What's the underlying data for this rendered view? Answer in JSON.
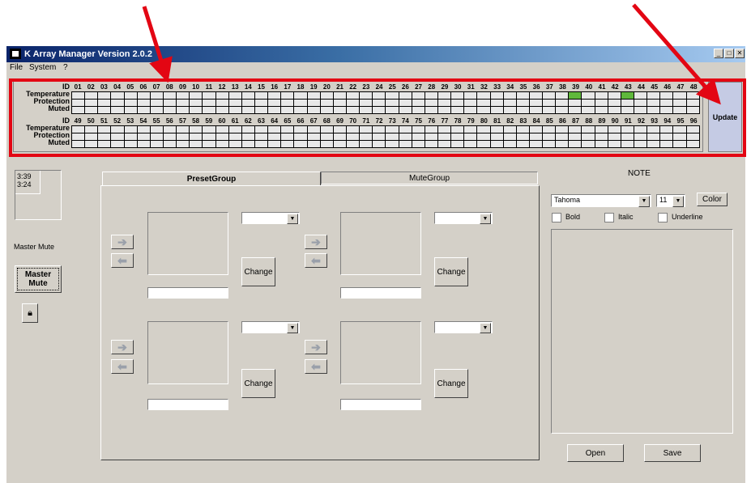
{
  "window": {
    "title": "K Array Manager Version 2.0.2",
    "caption_buttons": [
      "_",
      "□",
      "✕"
    ]
  },
  "menu": [
    "File",
    "System",
    "?"
  ],
  "status": {
    "id_label": "ID",
    "rows": [
      "Temperature",
      "Protection",
      "Muted"
    ],
    "top_ids": [
      "01",
      "02",
      "03",
      "04",
      "05",
      "06",
      "07",
      "08",
      "09",
      "10",
      "11",
      "12",
      "13",
      "14",
      "15",
      "16",
      "17",
      "18",
      "19",
      "20",
      "21",
      "22",
      "23",
      "24",
      "25",
      "26",
      "27",
      "28",
      "29",
      "30",
      "31",
      "32",
      "33",
      "34",
      "35",
      "36",
      "37",
      "38",
      "39",
      "40",
      "41",
      "42",
      "43",
      "44",
      "45",
      "46",
      "47",
      "48"
    ],
    "bottom_ids": [
      "49",
      "50",
      "51",
      "52",
      "53",
      "54",
      "55",
      "56",
      "57",
      "58",
      "59",
      "60",
      "61",
      "62",
      "63",
      "64",
      "65",
      "66",
      "67",
      "68",
      "69",
      "70",
      "71",
      "72",
      "73",
      "74",
      "75",
      "76",
      "77",
      "78",
      "79",
      "80",
      "81",
      "82",
      "83",
      "84",
      "85",
      "86",
      "87",
      "88",
      "89",
      "90",
      "91",
      "92",
      "93",
      "94",
      "95",
      "96"
    ],
    "active_top": [
      38,
      42
    ],
    "active_color": "#5fb83b",
    "update_label": "Update"
  },
  "left": {
    "time": "3:39\n3:24",
    "master_mute_caption": "Master Mute",
    "master_mute_button": "Master\nMute"
  },
  "tabs": [
    "PresetGroup",
    "MuteGroup"
  ],
  "groups": [
    {
      "change_label": "Change"
    },
    {
      "change_label": "Change"
    },
    {
      "change_label": "Change"
    },
    {
      "change_label": "Change"
    }
  ],
  "note": {
    "title": "NOTE",
    "font_family": "Tahoma",
    "font_size": "11",
    "color_button": "Color",
    "bold": "Bold",
    "italic": "Italic",
    "underline": "Underline",
    "open_button": "Open",
    "save_button": "Save"
  },
  "colors": {
    "annotation_red": "#e30613",
    "update_button_bg": "#c5cbe4",
    "title_gradient_start": "#0a246a"
  }
}
